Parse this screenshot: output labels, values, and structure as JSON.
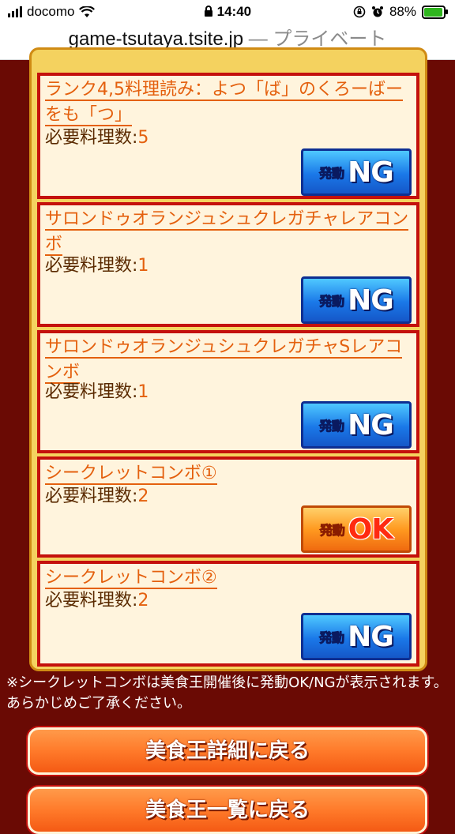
{
  "status_bar": {
    "carrier": "docomo",
    "time": "14:40",
    "battery": "88%",
    "signal_icon": "signal-bars-icon",
    "wifi_icon": "wifi-icon",
    "lock_icon": "lock-icon",
    "orientation_lock_icon": "orientation-lock-icon",
    "alarm_icon": "alarm-icon",
    "battery_icon": "battery-charging-icon"
  },
  "url_bar": {
    "domain": "game-tsutaya.tsite.jp",
    "suffix": " — プライベート"
  },
  "combos": [
    {
      "title": "ランク4,5料理読み：よつ「ば」のくろーばーをも「つ」",
      "req_label": "必要料理数:",
      "req_value": "5",
      "status": "NG"
    },
    {
      "title": "サロンドゥオランジュシュクレガチャレアコンボ",
      "req_label": "必要料理数:",
      "req_value": "1",
      "status": "NG"
    },
    {
      "title": "サロンドゥオランジュシュクレガチャSレアコンボ",
      "req_label": "必要料理数:",
      "req_value": "1",
      "status": "NG"
    },
    {
      "title": "シークレットコンボ①",
      "req_label": "必要料理数:",
      "req_value": "2",
      "status": "OK"
    },
    {
      "title": "シークレットコンボ②",
      "req_label": "必要料理数:",
      "req_value": "2",
      "status": "NG"
    }
  ],
  "badge_prefix": "発動",
  "note": "※シークレットコンボは美食王開催後に発動OK/NGが表示されます。あらかじめご了承ください。",
  "buttons": {
    "back_detail": "美食王詳細に戻る",
    "back_list": "美食王一覧に戻る"
  },
  "colors": {
    "page_background": "#6a0a04",
    "card_border": "#c4100c",
    "card_background": "#fff4dd",
    "title_link": "#e4600e",
    "ng_badge": "#1a78e8",
    "ok_badge": "#ff9a20"
  }
}
